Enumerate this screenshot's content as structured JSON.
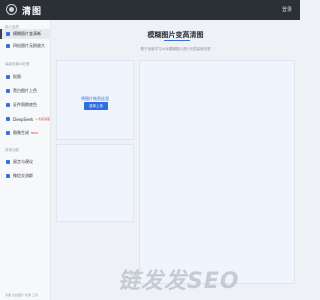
{
  "header": {
    "brand": "清图",
    "login": "登录"
  },
  "sidebar": {
    "sections": [
      {
        "title": "核心品质",
        "items": [
          "模糊图片变清晰",
          "四倍图片无损放大"
        ]
      },
      {
        "title": "高级场景AI处理",
        "items": [
          "抠图",
          "黑白图片上色",
          "证件照换底色",
          "DeepSeek",
          "图像生成"
        ]
      },
      {
        "title": "其他功能",
        "items": [
          "留言与建议",
          "微信交流群"
        ]
      }
    ],
    "badges": {
      "deepseek": "+卡顿深度",
      "image_gen": "NEW"
    },
    "footer": "清图 在线图片 处理 工具"
  },
  "main": {
    "title": "模糊图片变高清图",
    "subtitle": "基于深度学习AI对模糊图片进行无损高清还原",
    "upload_text": "将图片拖到这里",
    "upload_button": "选择上传"
  },
  "watermark": "链发发SEO"
}
